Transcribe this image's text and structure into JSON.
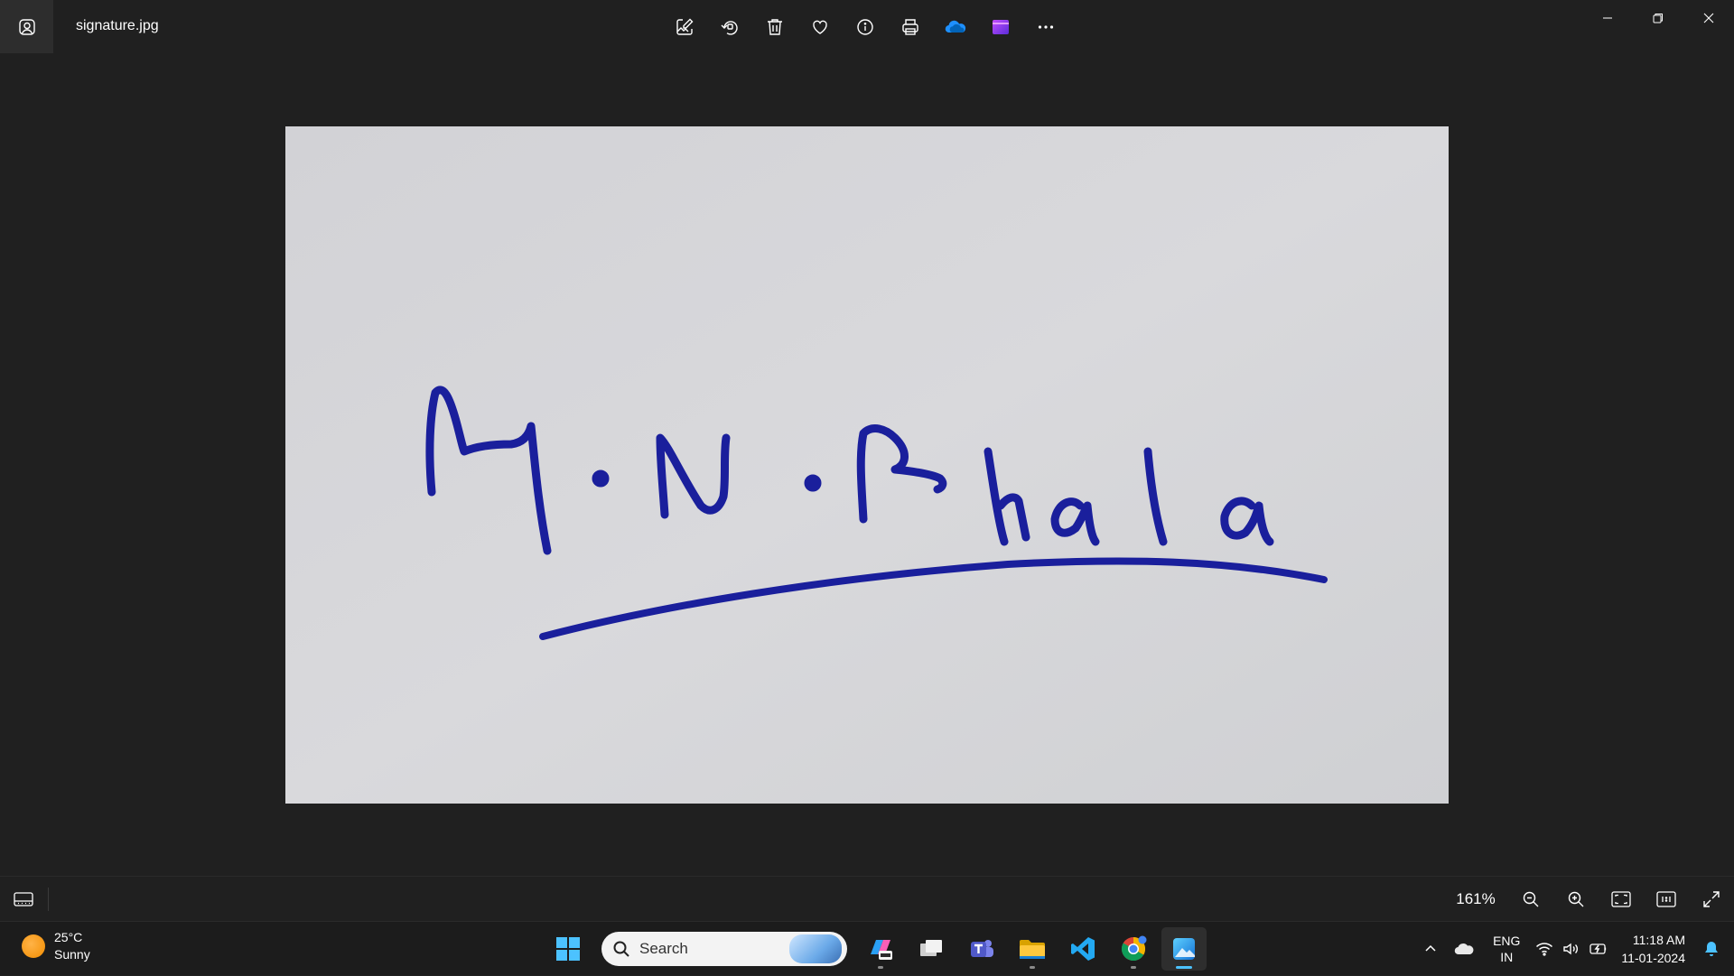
{
  "window": {
    "filename": "signature.jpg",
    "toolbar": {
      "items": [
        {
          "name": "edit-image-button",
          "icon": "edit-image-icon"
        },
        {
          "name": "rotate-button",
          "icon": "rotate-icon"
        },
        {
          "name": "delete-button",
          "icon": "trash-icon"
        },
        {
          "name": "favorite-button",
          "icon": "heart-icon"
        },
        {
          "name": "file-info-button",
          "icon": "info-icon"
        },
        {
          "name": "print-button",
          "icon": "printer-icon"
        },
        {
          "name": "onedrive-button",
          "icon": "onedrive-icon"
        },
        {
          "name": "clipchamp-button",
          "icon": "clipchamp-icon"
        },
        {
          "name": "more-options-button",
          "icon": "more-icon"
        }
      ]
    },
    "controls": [
      "minimize-icon",
      "restore-icon",
      "close-icon"
    ]
  },
  "image": {
    "signature_text": "M.N. Bhala",
    "ink_color": "#1a1f9c",
    "paper_color": "#d5d5d8"
  },
  "statusbar": {
    "zoom": "161%"
  },
  "taskbar": {
    "weather": {
      "temp": "25°C",
      "condition": "Sunny"
    },
    "search_placeholder": "Search",
    "apps": [
      "start",
      "copilot",
      "task-view",
      "teams",
      "file-explorer",
      "vscode",
      "chrome",
      "photos"
    ],
    "language": {
      "line1": "ENG",
      "line2": "IN"
    },
    "clock": {
      "time": "11:18 AM",
      "date": "11-01-2024"
    }
  },
  "colors": {
    "background": "#202020",
    "taskbar": "#1c1c1c",
    "accent": "#4cc2ff"
  }
}
